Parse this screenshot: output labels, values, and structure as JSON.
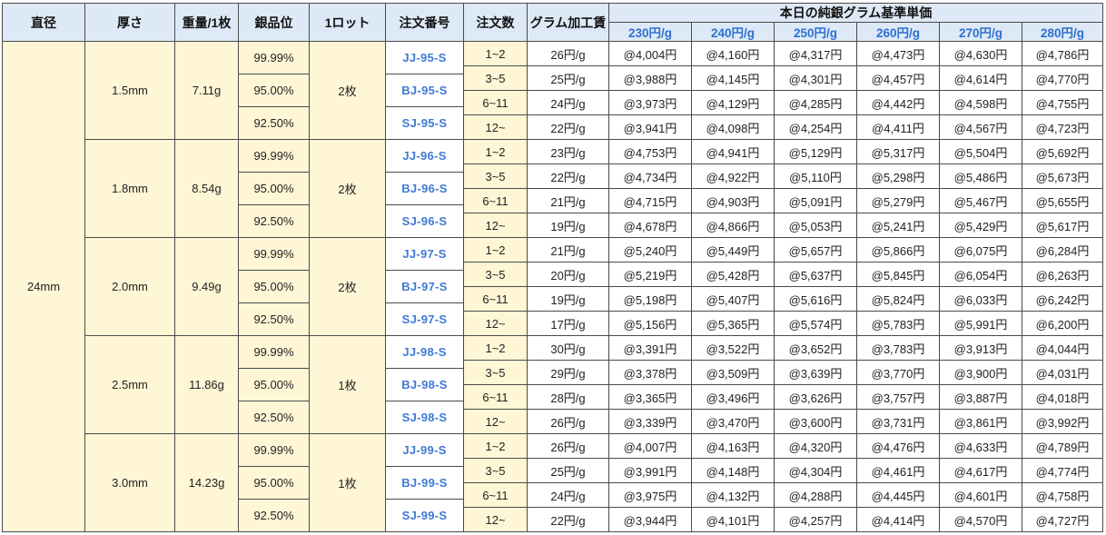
{
  "headers": {
    "diameter": "直径",
    "thickness": "厚さ",
    "weight": "重量/1枚",
    "purity": "銀品位",
    "lot": "1ロット",
    "order_no": "注文番号",
    "qty": "注文数",
    "fee": "グラム加工賃",
    "base_price": "本日の純銀グラム基準単価",
    "price_cols": [
      "230円/g",
      "240円/g",
      "250円/g",
      "260円/g",
      "270円/g",
      "280円/g"
    ]
  },
  "diameter": "24mm",
  "groups": [
    {
      "thickness": "1.5mm",
      "weight": "7.11g",
      "lot": "2枚",
      "purities": [
        {
          "purity": "99.99%",
          "code": "JJ-95-S"
        },
        {
          "purity": "95.00%",
          "code": "BJ-95-S"
        },
        {
          "purity": "92.50%",
          "code": "SJ-95-S"
        }
      ],
      "rows": [
        {
          "qty": "1~2",
          "fee": "26円/g",
          "prices": [
            "@4,004円",
            "@4,160円",
            "@4,317円",
            "@4,473円",
            "@4,630円",
            "@4,786円"
          ]
        },
        {
          "qty": "3~5",
          "fee": "25円/g",
          "prices": [
            "@3,988円",
            "@4,145円",
            "@4,301円",
            "@4,457円",
            "@4,614円",
            "@4,770円"
          ]
        },
        {
          "qty": "6~11",
          "fee": "24円/g",
          "prices": [
            "@3,973円",
            "@4,129円",
            "@4,285円",
            "@4,442円",
            "@4,598円",
            "@4,755円"
          ]
        },
        {
          "qty": "12~",
          "fee": "22円/g",
          "prices": [
            "@3,941円",
            "@4,098円",
            "@4,254円",
            "@4,411円",
            "@4,567円",
            "@4,723円"
          ]
        }
      ]
    },
    {
      "thickness": "1.8mm",
      "weight": "8.54g",
      "lot": "2枚",
      "purities": [
        {
          "purity": "99.99%",
          "code": "JJ-96-S"
        },
        {
          "purity": "95.00%",
          "code": "BJ-96-S"
        },
        {
          "purity": "92.50%",
          "code": "SJ-96-S"
        }
      ],
      "rows": [
        {
          "qty": "1~2",
          "fee": "23円/g",
          "prices": [
            "@4,753円",
            "@4,941円",
            "@5,129円",
            "@5,317円",
            "@5,504円",
            "@5,692円"
          ]
        },
        {
          "qty": "3~5",
          "fee": "22円/g",
          "prices": [
            "@4,734円",
            "@4,922円",
            "@5,110円",
            "@5,298円",
            "@5,486円",
            "@5,673円"
          ]
        },
        {
          "qty": "6~11",
          "fee": "21円/g",
          "prices": [
            "@4,715円",
            "@4,903円",
            "@5,091円",
            "@5,279円",
            "@5,467円",
            "@5,655円"
          ]
        },
        {
          "qty": "12~",
          "fee": "19円/g",
          "prices": [
            "@4,678円",
            "@4,866円",
            "@5,053円",
            "@5,241円",
            "@5,429円",
            "@5,617円"
          ]
        }
      ]
    },
    {
      "thickness": "2.0mm",
      "weight": "9.49g",
      "lot": "2枚",
      "purities": [
        {
          "purity": "99.99%",
          "code": "JJ-97-S"
        },
        {
          "purity": "95.00%",
          "code": "BJ-97-S"
        },
        {
          "purity": "92.50%",
          "code": "SJ-97-S"
        }
      ],
      "rows": [
        {
          "qty": "1~2",
          "fee": "21円/g",
          "prices": [
            "@5,240円",
            "@5,449円",
            "@5,657円",
            "@5,866円",
            "@6,075円",
            "@6,284円"
          ]
        },
        {
          "qty": "3~5",
          "fee": "20円/g",
          "prices": [
            "@5,219円",
            "@5,428円",
            "@5,637円",
            "@5,845円",
            "@6,054円",
            "@6,263円"
          ]
        },
        {
          "qty": "6~11",
          "fee": "19円/g",
          "prices": [
            "@5,198円",
            "@5,407円",
            "@5,616円",
            "@5,824円",
            "@6,033円",
            "@6,242円"
          ]
        },
        {
          "qty": "12~",
          "fee": "17円/g",
          "prices": [
            "@5,156円",
            "@5,365円",
            "@5,574円",
            "@5,783円",
            "@5,991円",
            "@6,200円"
          ]
        }
      ]
    },
    {
      "thickness": "2.5mm",
      "weight": "11.86g",
      "lot": "1枚",
      "purities": [
        {
          "purity": "99.99%",
          "code": "JJ-98-S"
        },
        {
          "purity": "95.00%",
          "code": "BJ-98-S"
        },
        {
          "purity": "92.50%",
          "code": "SJ-98-S"
        }
      ],
      "rows": [
        {
          "qty": "1~2",
          "fee": "30円/g",
          "prices": [
            "@3,391円",
            "@3,522円",
            "@3,652円",
            "@3,783円",
            "@3,913円",
            "@4,044円"
          ]
        },
        {
          "qty": "3~5",
          "fee": "29円/g",
          "prices": [
            "@3,378円",
            "@3,509円",
            "@3,639円",
            "@3,770円",
            "@3,900円",
            "@4,031円"
          ]
        },
        {
          "qty": "6~11",
          "fee": "28円/g",
          "prices": [
            "@3,365円",
            "@3,496円",
            "@3,626円",
            "@3,757円",
            "@3,887円",
            "@4,018円"
          ]
        },
        {
          "qty": "12~",
          "fee": "26円/g",
          "prices": [
            "@3,339円",
            "@3,470円",
            "@3,600円",
            "@3,731円",
            "@3,861円",
            "@3,992円"
          ]
        }
      ]
    },
    {
      "thickness": "3.0mm",
      "weight": "14.23g",
      "lot": "1枚",
      "purities": [
        {
          "purity": "99.99%",
          "code": "JJ-99-S"
        },
        {
          "purity": "95.00%",
          "code": "BJ-99-S"
        },
        {
          "purity": "92.50%",
          "code": "SJ-99-S"
        }
      ],
      "rows": [
        {
          "qty": "1~2",
          "fee": "26円/g",
          "prices": [
            "@4,007円",
            "@4,163円",
            "@4,320円",
            "@4,476円",
            "@4,633円",
            "@4,789円"
          ]
        },
        {
          "qty": "3~5",
          "fee": "25円/g",
          "prices": [
            "@3,991円",
            "@4,148円",
            "@4,304円",
            "@4,461円",
            "@4,617円",
            "@4,774円"
          ]
        },
        {
          "qty": "6~11",
          "fee": "24円/g",
          "prices": [
            "@3,975円",
            "@4,132円",
            "@4,288円",
            "@4,445円",
            "@4,601円",
            "@4,758円"
          ]
        },
        {
          "qty": "12~",
          "fee": "22円/g",
          "prices": [
            "@3,944円",
            "@4,101円",
            "@4,257円",
            "@4,414円",
            "@4,570円",
            "@4,727円"
          ]
        }
      ]
    }
  ]
}
